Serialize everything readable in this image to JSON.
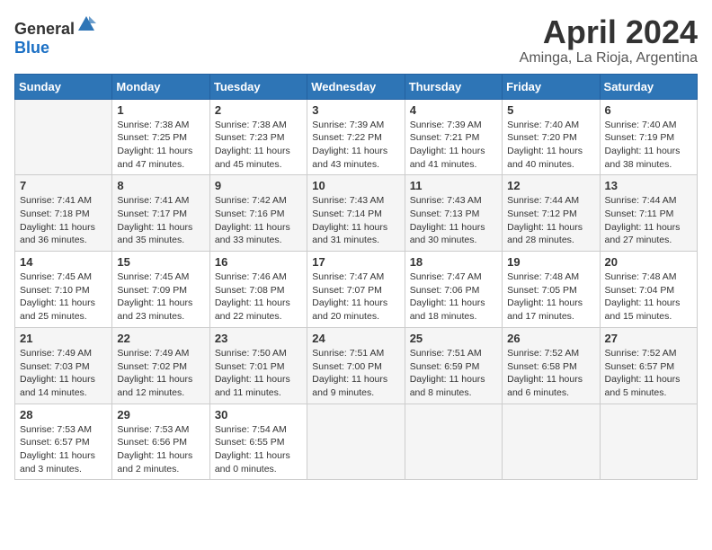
{
  "logo": {
    "general": "General",
    "blue": "Blue"
  },
  "header": {
    "month": "April 2024",
    "location": "Aminga, La Rioja, Argentina"
  },
  "weekdays": [
    "Sunday",
    "Monday",
    "Tuesday",
    "Wednesday",
    "Thursday",
    "Friday",
    "Saturday"
  ],
  "weeks": [
    [
      {
        "day": "",
        "sunrise": "",
        "sunset": "",
        "daylight": ""
      },
      {
        "day": "1",
        "sunrise": "Sunrise: 7:38 AM",
        "sunset": "Sunset: 7:25 PM",
        "daylight": "Daylight: 11 hours and 47 minutes."
      },
      {
        "day": "2",
        "sunrise": "Sunrise: 7:38 AM",
        "sunset": "Sunset: 7:23 PM",
        "daylight": "Daylight: 11 hours and 45 minutes."
      },
      {
        "day": "3",
        "sunrise": "Sunrise: 7:39 AM",
        "sunset": "Sunset: 7:22 PM",
        "daylight": "Daylight: 11 hours and 43 minutes."
      },
      {
        "day": "4",
        "sunrise": "Sunrise: 7:39 AM",
        "sunset": "Sunset: 7:21 PM",
        "daylight": "Daylight: 11 hours and 41 minutes."
      },
      {
        "day": "5",
        "sunrise": "Sunrise: 7:40 AM",
        "sunset": "Sunset: 7:20 PM",
        "daylight": "Daylight: 11 hours and 40 minutes."
      },
      {
        "day": "6",
        "sunrise": "Sunrise: 7:40 AM",
        "sunset": "Sunset: 7:19 PM",
        "daylight": "Daylight: 11 hours and 38 minutes."
      }
    ],
    [
      {
        "day": "7",
        "sunrise": "Sunrise: 7:41 AM",
        "sunset": "Sunset: 7:18 PM",
        "daylight": "Daylight: 11 hours and 36 minutes."
      },
      {
        "day": "8",
        "sunrise": "Sunrise: 7:41 AM",
        "sunset": "Sunset: 7:17 PM",
        "daylight": "Daylight: 11 hours and 35 minutes."
      },
      {
        "day": "9",
        "sunrise": "Sunrise: 7:42 AM",
        "sunset": "Sunset: 7:16 PM",
        "daylight": "Daylight: 11 hours and 33 minutes."
      },
      {
        "day": "10",
        "sunrise": "Sunrise: 7:43 AM",
        "sunset": "Sunset: 7:14 PM",
        "daylight": "Daylight: 11 hours and 31 minutes."
      },
      {
        "day": "11",
        "sunrise": "Sunrise: 7:43 AM",
        "sunset": "Sunset: 7:13 PM",
        "daylight": "Daylight: 11 hours and 30 minutes."
      },
      {
        "day": "12",
        "sunrise": "Sunrise: 7:44 AM",
        "sunset": "Sunset: 7:12 PM",
        "daylight": "Daylight: 11 hours and 28 minutes."
      },
      {
        "day": "13",
        "sunrise": "Sunrise: 7:44 AM",
        "sunset": "Sunset: 7:11 PM",
        "daylight": "Daylight: 11 hours and 27 minutes."
      }
    ],
    [
      {
        "day": "14",
        "sunrise": "Sunrise: 7:45 AM",
        "sunset": "Sunset: 7:10 PM",
        "daylight": "Daylight: 11 hours and 25 minutes."
      },
      {
        "day": "15",
        "sunrise": "Sunrise: 7:45 AM",
        "sunset": "Sunset: 7:09 PM",
        "daylight": "Daylight: 11 hours and 23 minutes."
      },
      {
        "day": "16",
        "sunrise": "Sunrise: 7:46 AM",
        "sunset": "Sunset: 7:08 PM",
        "daylight": "Daylight: 11 hours and 22 minutes."
      },
      {
        "day": "17",
        "sunrise": "Sunrise: 7:47 AM",
        "sunset": "Sunset: 7:07 PM",
        "daylight": "Daylight: 11 hours and 20 minutes."
      },
      {
        "day": "18",
        "sunrise": "Sunrise: 7:47 AM",
        "sunset": "Sunset: 7:06 PM",
        "daylight": "Daylight: 11 hours and 18 minutes."
      },
      {
        "day": "19",
        "sunrise": "Sunrise: 7:48 AM",
        "sunset": "Sunset: 7:05 PM",
        "daylight": "Daylight: 11 hours and 17 minutes."
      },
      {
        "day": "20",
        "sunrise": "Sunrise: 7:48 AM",
        "sunset": "Sunset: 7:04 PM",
        "daylight": "Daylight: 11 hours and 15 minutes."
      }
    ],
    [
      {
        "day": "21",
        "sunrise": "Sunrise: 7:49 AM",
        "sunset": "Sunset: 7:03 PM",
        "daylight": "Daylight: 11 hours and 14 minutes."
      },
      {
        "day": "22",
        "sunrise": "Sunrise: 7:49 AM",
        "sunset": "Sunset: 7:02 PM",
        "daylight": "Daylight: 11 hours and 12 minutes."
      },
      {
        "day": "23",
        "sunrise": "Sunrise: 7:50 AM",
        "sunset": "Sunset: 7:01 PM",
        "daylight": "Daylight: 11 hours and 11 minutes."
      },
      {
        "day": "24",
        "sunrise": "Sunrise: 7:51 AM",
        "sunset": "Sunset: 7:00 PM",
        "daylight": "Daylight: 11 hours and 9 minutes."
      },
      {
        "day": "25",
        "sunrise": "Sunrise: 7:51 AM",
        "sunset": "Sunset: 6:59 PM",
        "daylight": "Daylight: 11 hours and 8 minutes."
      },
      {
        "day": "26",
        "sunrise": "Sunrise: 7:52 AM",
        "sunset": "Sunset: 6:58 PM",
        "daylight": "Daylight: 11 hours and 6 minutes."
      },
      {
        "day": "27",
        "sunrise": "Sunrise: 7:52 AM",
        "sunset": "Sunset: 6:57 PM",
        "daylight": "Daylight: 11 hours and 5 minutes."
      }
    ],
    [
      {
        "day": "28",
        "sunrise": "Sunrise: 7:53 AM",
        "sunset": "Sunset: 6:57 PM",
        "daylight": "Daylight: 11 hours and 3 minutes."
      },
      {
        "day": "29",
        "sunrise": "Sunrise: 7:53 AM",
        "sunset": "Sunset: 6:56 PM",
        "daylight": "Daylight: 11 hours and 2 minutes."
      },
      {
        "day": "30",
        "sunrise": "Sunrise: 7:54 AM",
        "sunset": "Sunset: 6:55 PM",
        "daylight": "Daylight: 11 hours and 0 minutes."
      },
      {
        "day": "",
        "sunrise": "",
        "sunset": "",
        "daylight": ""
      },
      {
        "day": "",
        "sunrise": "",
        "sunset": "",
        "daylight": ""
      },
      {
        "day": "",
        "sunrise": "",
        "sunset": "",
        "daylight": ""
      },
      {
        "day": "",
        "sunrise": "",
        "sunset": "",
        "daylight": ""
      }
    ]
  ]
}
